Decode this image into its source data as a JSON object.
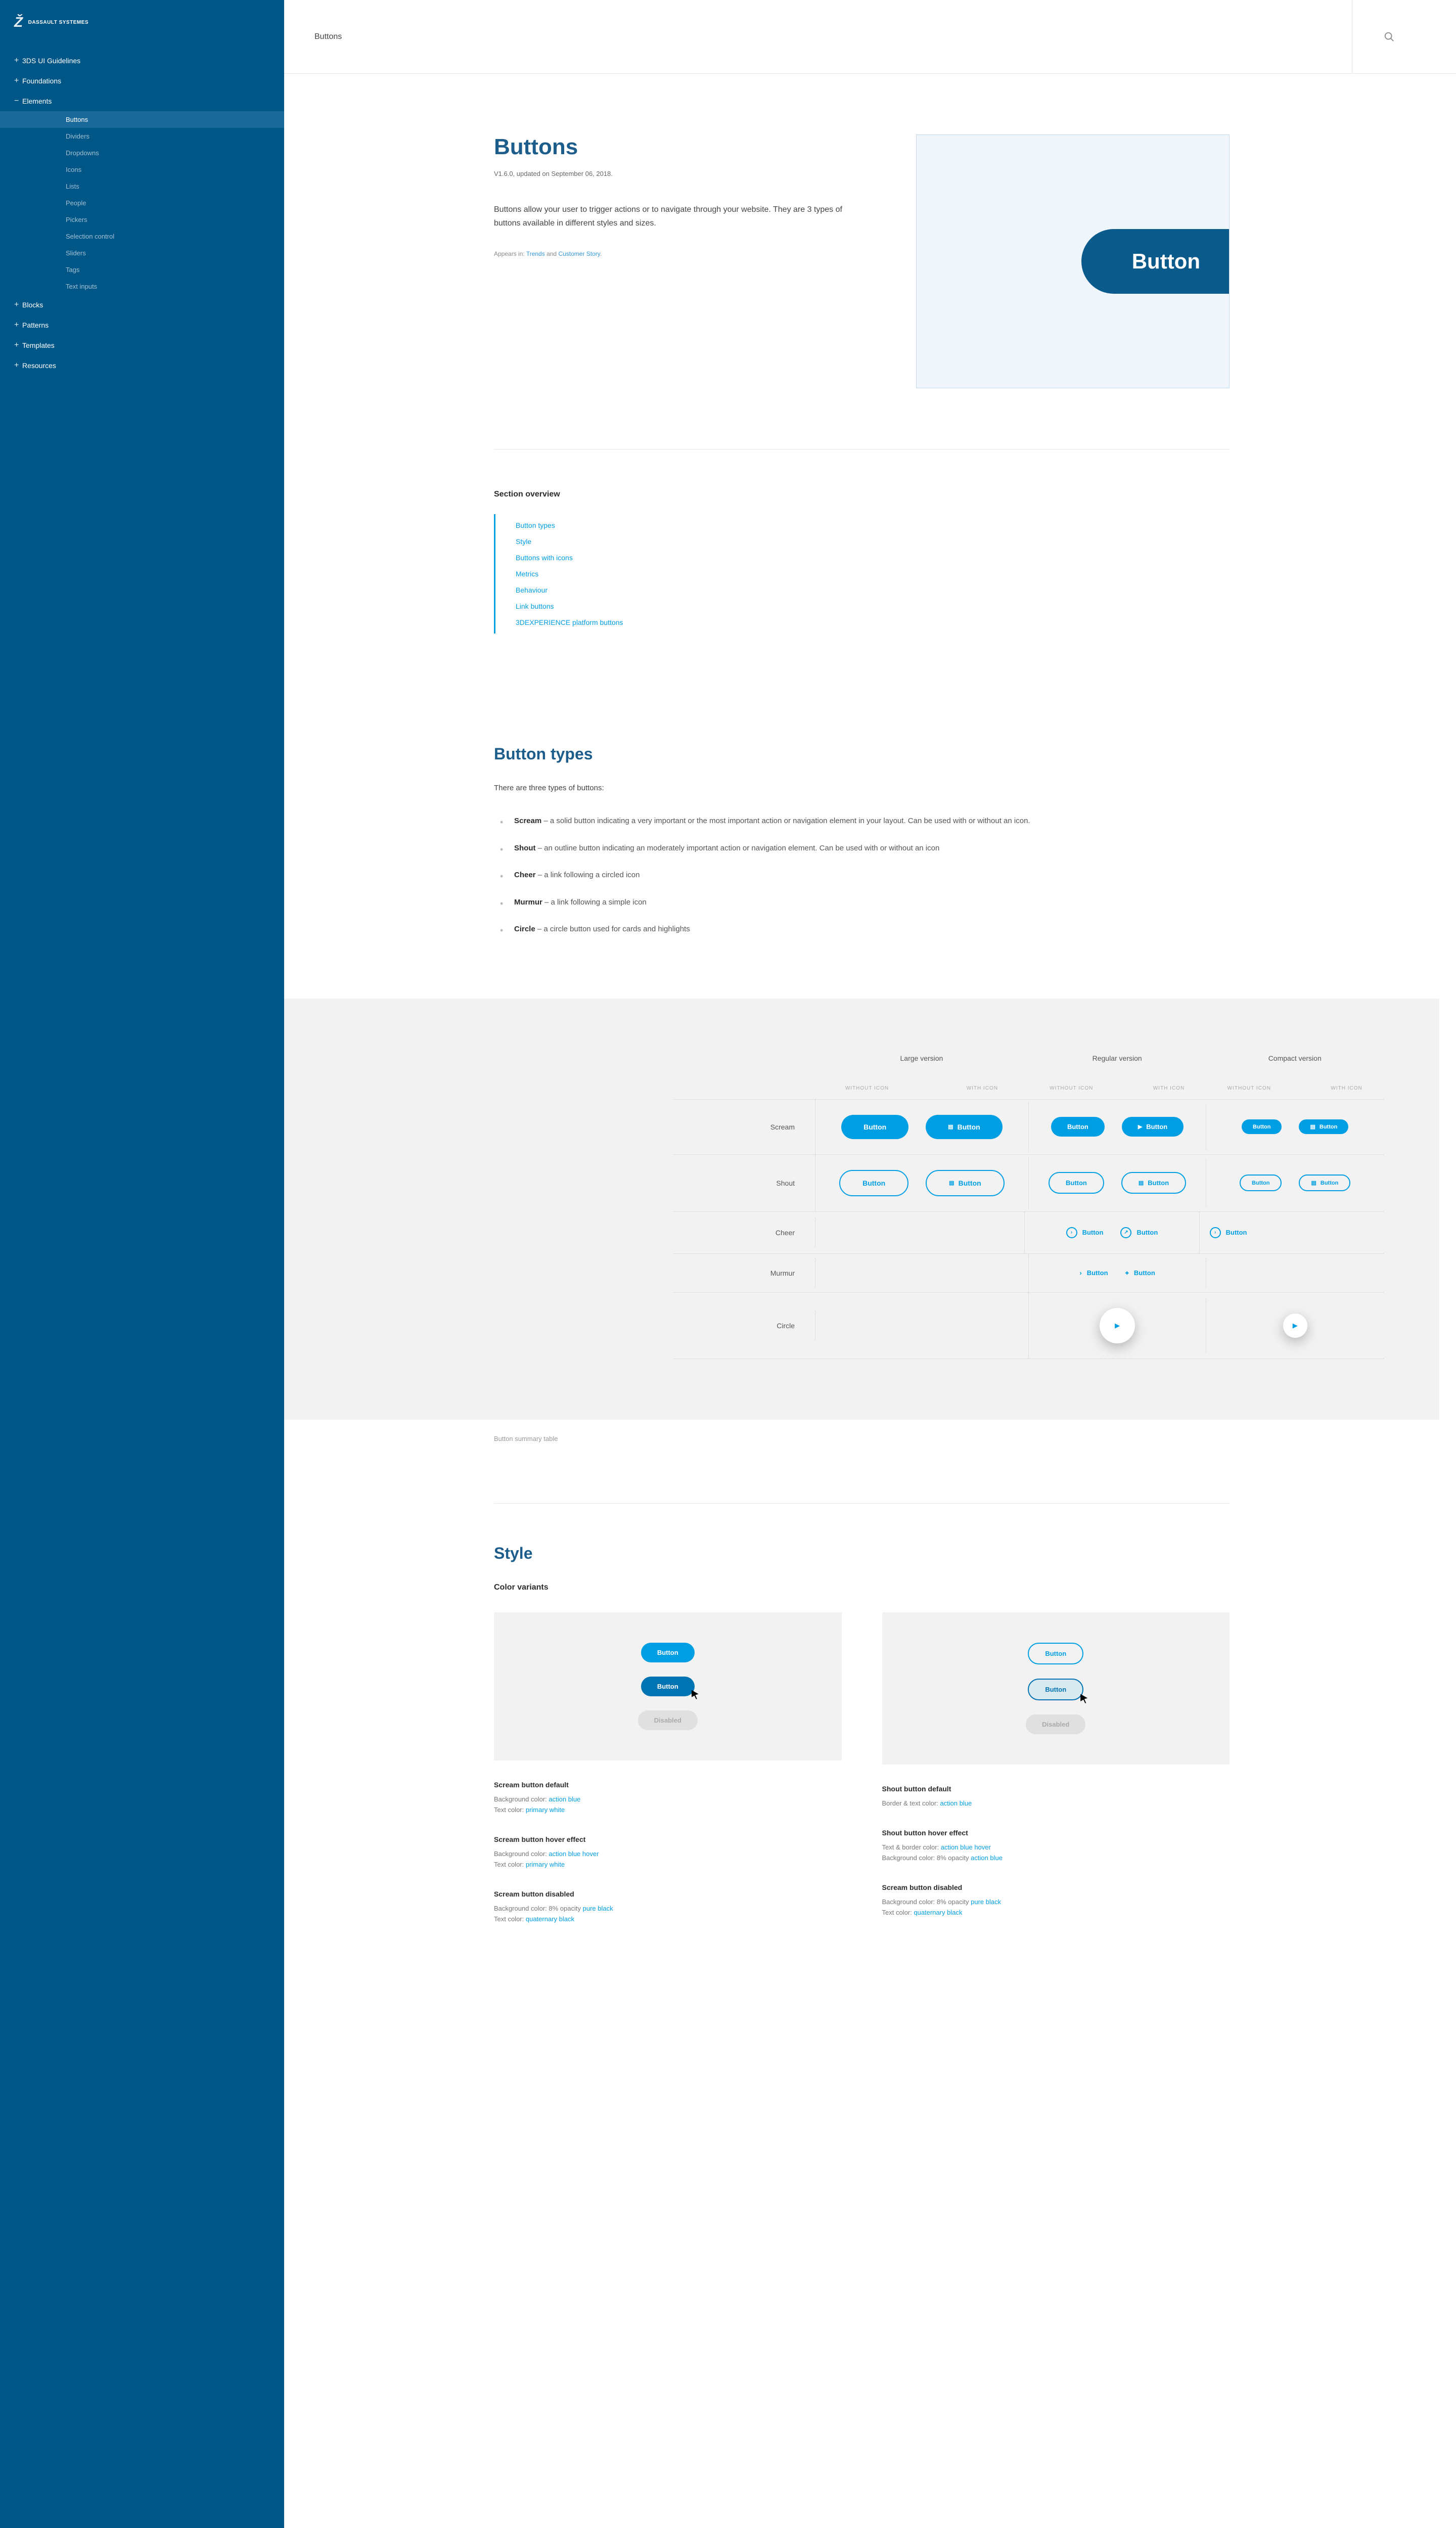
{
  "brand": "DASSAULT SYSTEMES",
  "nav": {
    "guidelines": "3DS UI Guidelines",
    "foundations": "Foundations",
    "elements": "Elements",
    "blocks": "Blocks",
    "patterns": "Patterns",
    "templates": "Templates",
    "resources": "Resources",
    "sub": {
      "buttons": "Buttons",
      "dividers": "Dividers",
      "dropdowns": "Dropdowns",
      "icons": "Icons",
      "lists": "Lists",
      "people": "People",
      "pickers": "Pickers",
      "selection": "Selection control",
      "sliders": "Sliders",
      "tags": "Tags",
      "text": "Text inputs"
    }
  },
  "topbar": {
    "title": "Buttons"
  },
  "hero": {
    "title": "Buttons",
    "meta": "V1.6.0, updated on September 06, 2018.",
    "lead": "Buttons allow your user to trigger actions or to navigate through your website. They are 3 types of buttons available in different styles and sizes.",
    "appears_prefix": "Appears in: ",
    "appears_l1": "Trends",
    "appears_and": " and ",
    "appears_l2": "Customer Story",
    "pill": "Button"
  },
  "overview": {
    "title": "Section overview",
    "items": [
      "Button types",
      "Style",
      "Buttons with icons",
      "Metrics",
      "Behaviour",
      "Link buttons",
      "3DEXPERIENCE platform buttons"
    ]
  },
  "types": {
    "title": "Button types",
    "intro": "There are three types of buttons:",
    "items": [
      {
        "name": "Scream",
        "desc": " – a solid button indicating a very important or the most important action or navigation element in your layout. Can be used with or without an icon."
      },
      {
        "name": "Shout",
        "desc": " – an outline button indicating an moderately important action or navigation element. Can be used with or without an icon"
      },
      {
        "name": "Cheer",
        "desc": " – a link following a circled icon"
      },
      {
        "name": "Murmur",
        "desc": " – a link following a simple icon"
      },
      {
        "name": "Circle",
        "desc": " – a circle button used for cards and highlights"
      }
    ]
  },
  "table": {
    "col_lg": "Large version",
    "col_md": "Regular version",
    "col_sm": "Compact version",
    "without": "WITHOUT ICON",
    "with": "WITH ICON",
    "rows": [
      "Scream",
      "Shout",
      "Cheer",
      "Murmur",
      "Circle"
    ],
    "btn": "Button",
    "caption": "Button summary table"
  },
  "style": {
    "title": "Style",
    "subtitle": "Color variants",
    "btn": "Button",
    "disabled": "Disabled",
    "scream_default_t": "Scream button default",
    "scream_default_l1p": "Background color: ",
    "scream_default_l1a": "action blue",
    "scream_default_l2p": "Text color: ",
    "scream_default_l2a": "primary white",
    "scream_hover_t": "Scream button hover effect",
    "scream_hover_l1p": "Background color: ",
    "scream_hover_l1a": "action blue hover",
    "scream_hover_l2p": "Text color: ",
    "scream_hover_l2a": "primary white",
    "scream_disabled_t": "Scream button disabled",
    "scream_disabled_l1p": "Background color: 8% opacity ",
    "scream_disabled_l1a": "pure black",
    "scream_disabled_l2p": "Text color: ",
    "scream_disabled_l2a": "quaternary black",
    "shout_default_t": "Shout button default",
    "shout_default_l1p": "Border & text color: ",
    "shout_default_l1a": "action blue",
    "shout_hover_t": "Shout button hover effect",
    "shout_hover_l1p": "Text & border color: ",
    "shout_hover_l1a": "action blue hover",
    "shout_hover_l2p": "Background color: 8% opacity ",
    "shout_hover_l2a": "action blue",
    "shout_disabled_t": "Scream button disabled",
    "shout_disabled_l1p": "Background color: 8% opacity ",
    "shout_disabled_l1a": "pure black",
    "shout_disabled_l2p": "Text color: ",
    "shout_disabled_l2a": "quaternary black"
  }
}
